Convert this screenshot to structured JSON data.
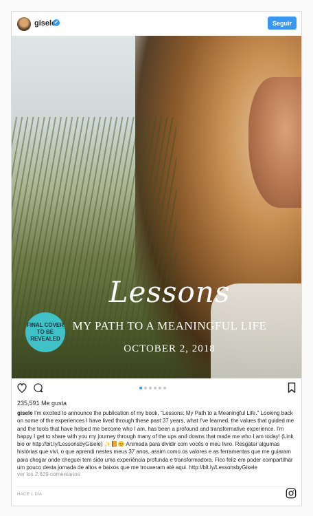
{
  "header": {
    "username": "gisele",
    "verified_mark": "✓",
    "follow_label": "Seguir"
  },
  "photo": {
    "title": "Lessons",
    "subtitle": "MY PATH TO A MEANINGFUL LIFE",
    "date": "OCTOBER 2, 2018",
    "badge": "FINAL COVER TO BE REVEALED",
    "badge_color": "#40c1c8"
  },
  "actions": {
    "like_icon": "heart-icon",
    "comment_icon": "comment-icon",
    "save_icon": "bookmark-icon",
    "carousel_dots": 6,
    "carousel_active_index": 0
  },
  "likes": "235,591 Me gusta",
  "caption": {
    "username": "gisele",
    "text": "I'm excited to announce the publication of my book, \"Lessons: My Path to a Meaningful Life.\" Looking back on some of the experiences I have lived through these past 37 years, what I've learned, the values that guided me and the tools that have helped me become who I am, has been a profound and transformative experience. I'm happy I get to share with you my journey through many of the ups and downs that made me who I am today! (Link bio or http://bit.ly/LessonsbyGisele) ✨📙😊 Animada para dividir com vocês o meu livro. Resgatar algumas histórias que vivi, o que aprendi nestes meus 37 anos, assim como os valores e as ferramentas que me guiaram para chegar onde cheguei tem sido uma experiência profunda e transformadora. Fico feliz em poder compartilhar um pouco desta jornada de altos e baixos que me trouxeram até aqui. http://bit.ly/LessonsbyGisele"
  },
  "comments_link": "ver los 2,629 comentarios",
  "timestamp": "HACE 1 DÍA",
  "footer_icon": "instagram-icon",
  "colors": {
    "accent": "#3897f0",
    "text": "#262626",
    "muted": "#999999"
  }
}
